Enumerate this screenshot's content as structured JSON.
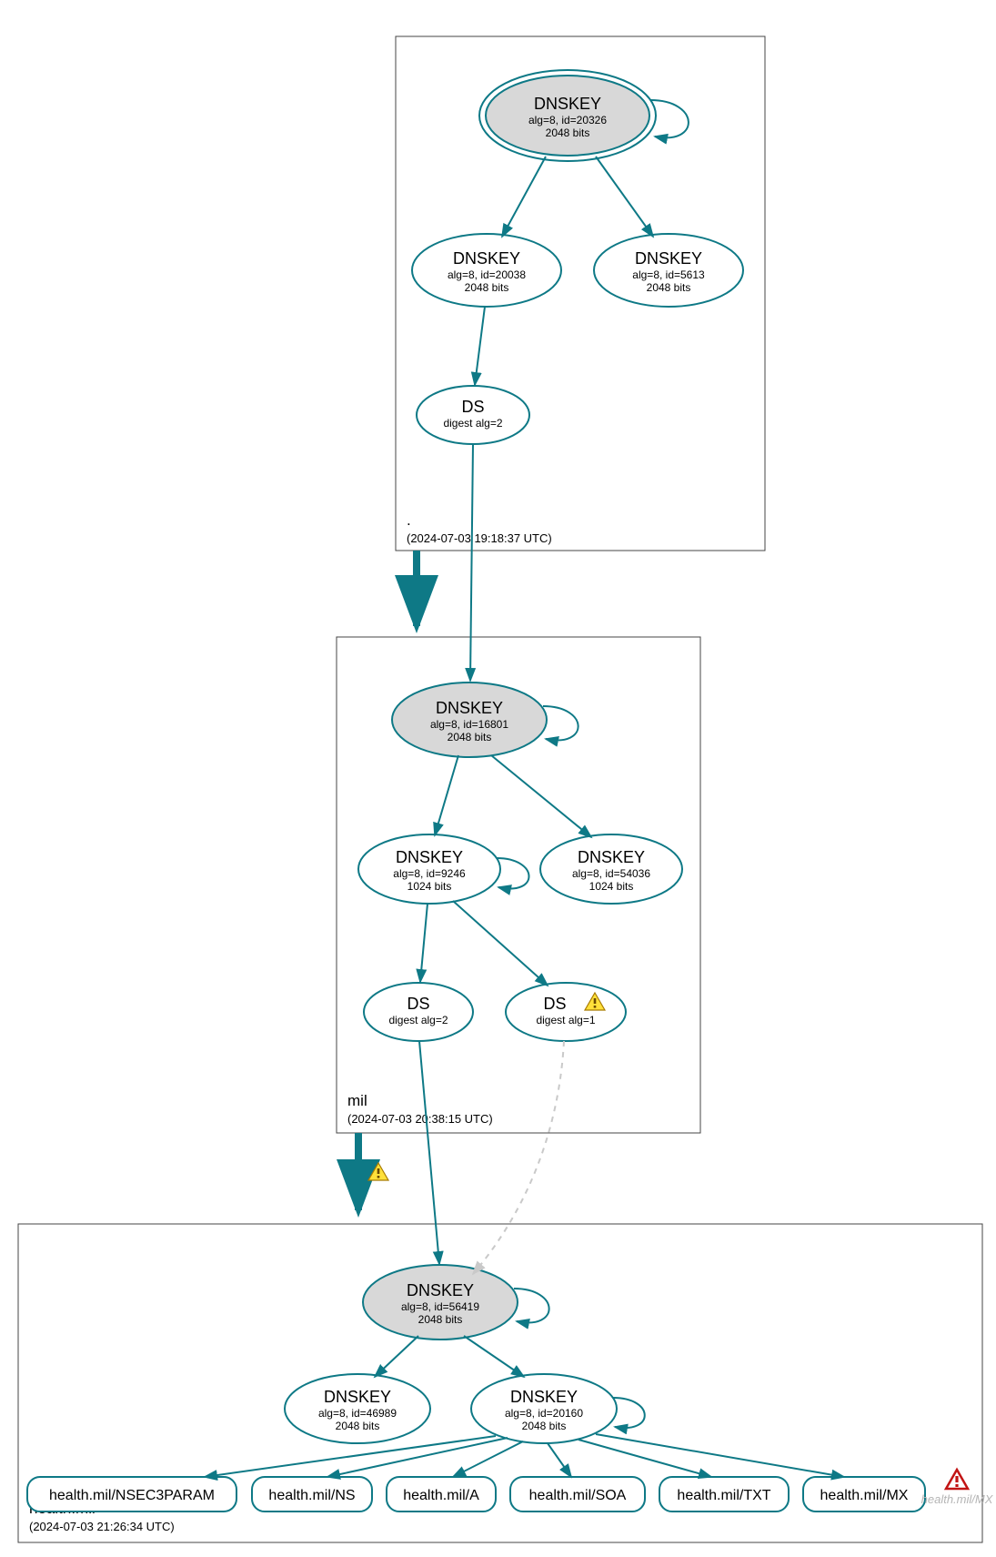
{
  "zones": {
    "root": {
      "title": ".",
      "time": "(2024-07-03 19:18:37 UTC)"
    },
    "mil": {
      "title": "mil",
      "time": "(2024-07-03 20:38:15 UTC)"
    },
    "health": {
      "title": "health.mil",
      "time": "(2024-07-03 21:26:34 UTC)"
    }
  },
  "nodes": {
    "root_ksk": {
      "t": "DNSKEY",
      "l1": "alg=8, id=20326",
      "l2": "2048 bits"
    },
    "root_zsk1": {
      "t": "DNSKEY",
      "l1": "alg=8, id=20038",
      "l2": "2048 bits"
    },
    "root_zsk2": {
      "t": "DNSKEY",
      "l1": "alg=8, id=5613",
      "l2": "2048 bits"
    },
    "root_ds": {
      "t": "DS",
      "l1": "digest alg=2",
      "l2": ""
    },
    "mil_ksk": {
      "t": "DNSKEY",
      "l1": "alg=8, id=16801",
      "l2": "2048 bits"
    },
    "mil_zsk1": {
      "t": "DNSKEY",
      "l1": "alg=8, id=9246",
      "l2": "1024 bits"
    },
    "mil_zsk2": {
      "t": "DNSKEY",
      "l1": "alg=8, id=54036",
      "l2": "1024 bits"
    },
    "mil_ds1": {
      "t": "DS",
      "l1": "digest alg=2",
      "l2": ""
    },
    "mil_ds2": {
      "t": "DS",
      "l1": "digest alg=1",
      "l2": ""
    },
    "health_ksk": {
      "t": "DNSKEY",
      "l1": "alg=8, id=56419",
      "l2": "2048 bits"
    },
    "health_zsk1": {
      "t": "DNSKEY",
      "l1": "alg=8, id=46989",
      "l2": "2048 bits"
    },
    "health_zsk2": {
      "t": "DNSKEY",
      "l1": "alg=8, id=20160",
      "l2": "2048 bits"
    }
  },
  "rr": {
    "nsec3": "health.mil/NSEC3PARAM",
    "ns": "health.mil/NS",
    "a": "health.mil/A",
    "soa": "health.mil/SOA",
    "txt": "health.mil/TXT",
    "mx": "health.mil/MX",
    "mx_err": "health.mil/MX"
  }
}
